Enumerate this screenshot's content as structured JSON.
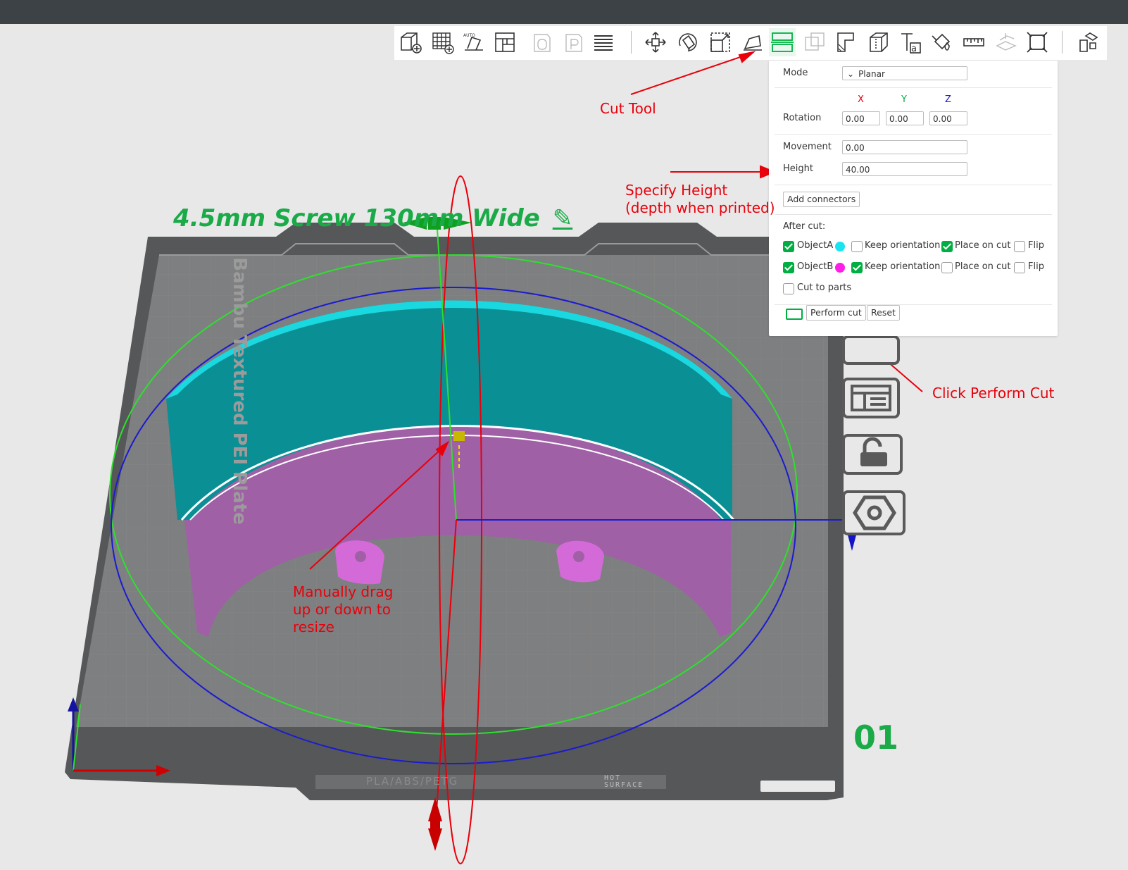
{
  "window": {
    "title": ""
  },
  "toolbar": {
    "icons": [
      "add-object-icon",
      "add-plate-icon",
      "auto-orient-icon",
      "arrange-icon",
      "plate-slice-icon",
      "plate-print-icon",
      "layers-icon",
      "move-icon",
      "rotate-icon",
      "scale-icon",
      "lay-on-face-icon",
      "cut-icon",
      "boolean-icon",
      "support-paint-icon",
      "seam-paint-icon",
      "text-icon",
      "color-paint-icon",
      "measure-icon",
      "assembly-icon",
      "fit-icon",
      "explode-icon"
    ]
  },
  "cut_panel": {
    "mode_label": "Mode",
    "mode_value": "Planar",
    "axis_x": "X",
    "axis_y": "Y",
    "axis_z": "Z",
    "rotation_label": "Rotation",
    "rotation_x": "0.00",
    "rotation_y": "0.00",
    "rotation_z": "0.00",
    "movement_label": "Movement",
    "movement_value": "0.00",
    "height_label": "Height",
    "height_value": "40.00",
    "add_connectors": "Add connectors",
    "after_cut_label": "After cut:",
    "objectA": {
      "label": "ObjectA",
      "checked": true,
      "color": "#19e4ef",
      "keep_orientation": false,
      "place_on_cut": true,
      "flip": false
    },
    "objectB": {
      "label": "ObjectB",
      "checked": true,
      "color": "#ff1ee8",
      "keep_orientation": true,
      "place_on_cut": false,
      "flip": false
    },
    "keep_orientation_label": "Keep orientation",
    "place_on_cut_label": "Place on cut",
    "flip_label": "Flip",
    "cut_to_parts_label": "Cut to parts",
    "perform_cut": "Perform cut",
    "reset": "Reset"
  },
  "scene": {
    "object_name": "4.5mm Screw 130mm Wide",
    "plate_brand": "Bambu Textured PEI Plate",
    "plate_number": "01",
    "plate_footer": "PLA/ABS/PETG",
    "hot_surface": "HOT SURFACE"
  },
  "annotations": {
    "cut_tool": "Cut Tool",
    "specify_height_1": "Specify Height",
    "specify_height_2": "(depth when printed)",
    "click_perform": "Click Perform Cut",
    "drag_1": "Manually drag",
    "drag_2": "up or down to",
    "drag_3": "resize"
  },
  "colors": {
    "accent": "#00ae42",
    "annotation": "#e8000b",
    "objectA": "#19e4ef",
    "objectB": "#ff1ee8"
  }
}
